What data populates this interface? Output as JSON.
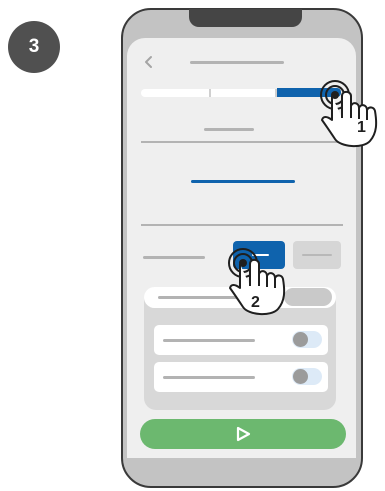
{
  "step": {
    "number": "3"
  },
  "callouts": [
    {
      "label": "1"
    },
    {
      "label": "2"
    }
  ],
  "tabs": {
    "count": 3,
    "selected_index": 2
  },
  "toggle_buttons": {
    "selected_index": 0
  },
  "settings_rows": [
    {
      "toggle_on": false
    },
    {
      "toggle_on": false
    }
  ],
  "actions": {
    "play_icon": "play-icon"
  },
  "colors": {
    "accent_blue": "#0f63ad",
    "play_green": "#6cb86f",
    "frame_gray": "#c3c3c3",
    "screen_bg": "#efefef",
    "badge_gray": "#505050"
  }
}
